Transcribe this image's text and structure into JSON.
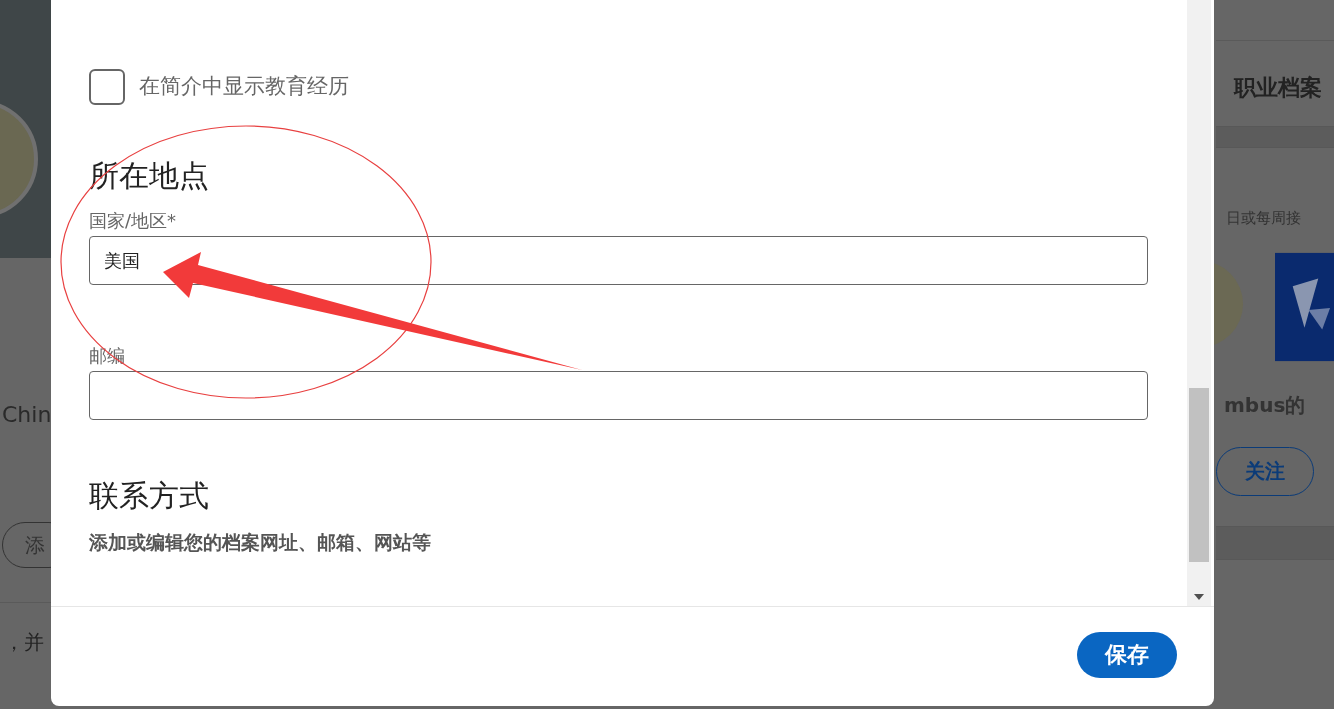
{
  "background_left": {
    "name": "Chin",
    "button": "添",
    "text": "，并"
  },
  "background_right": {
    "heading": "职业档案",
    "subtitle": "日或每周接",
    "company": "mbus的",
    "follow_button": "关注"
  },
  "dialog": {
    "checkbox": {
      "label": "在简介中显示教育经历",
      "checked": false
    },
    "location": {
      "heading": "所在地点",
      "fields": [
        {
          "label": "国家/地区*",
          "value": "美国"
        },
        {
          "label": "邮编"
        }
      ]
    },
    "contact": {
      "heading": "联系方式",
      "description": "添加或编辑您的档案网址、邮箱、网站等"
    },
    "save_button": "保存"
  }
}
